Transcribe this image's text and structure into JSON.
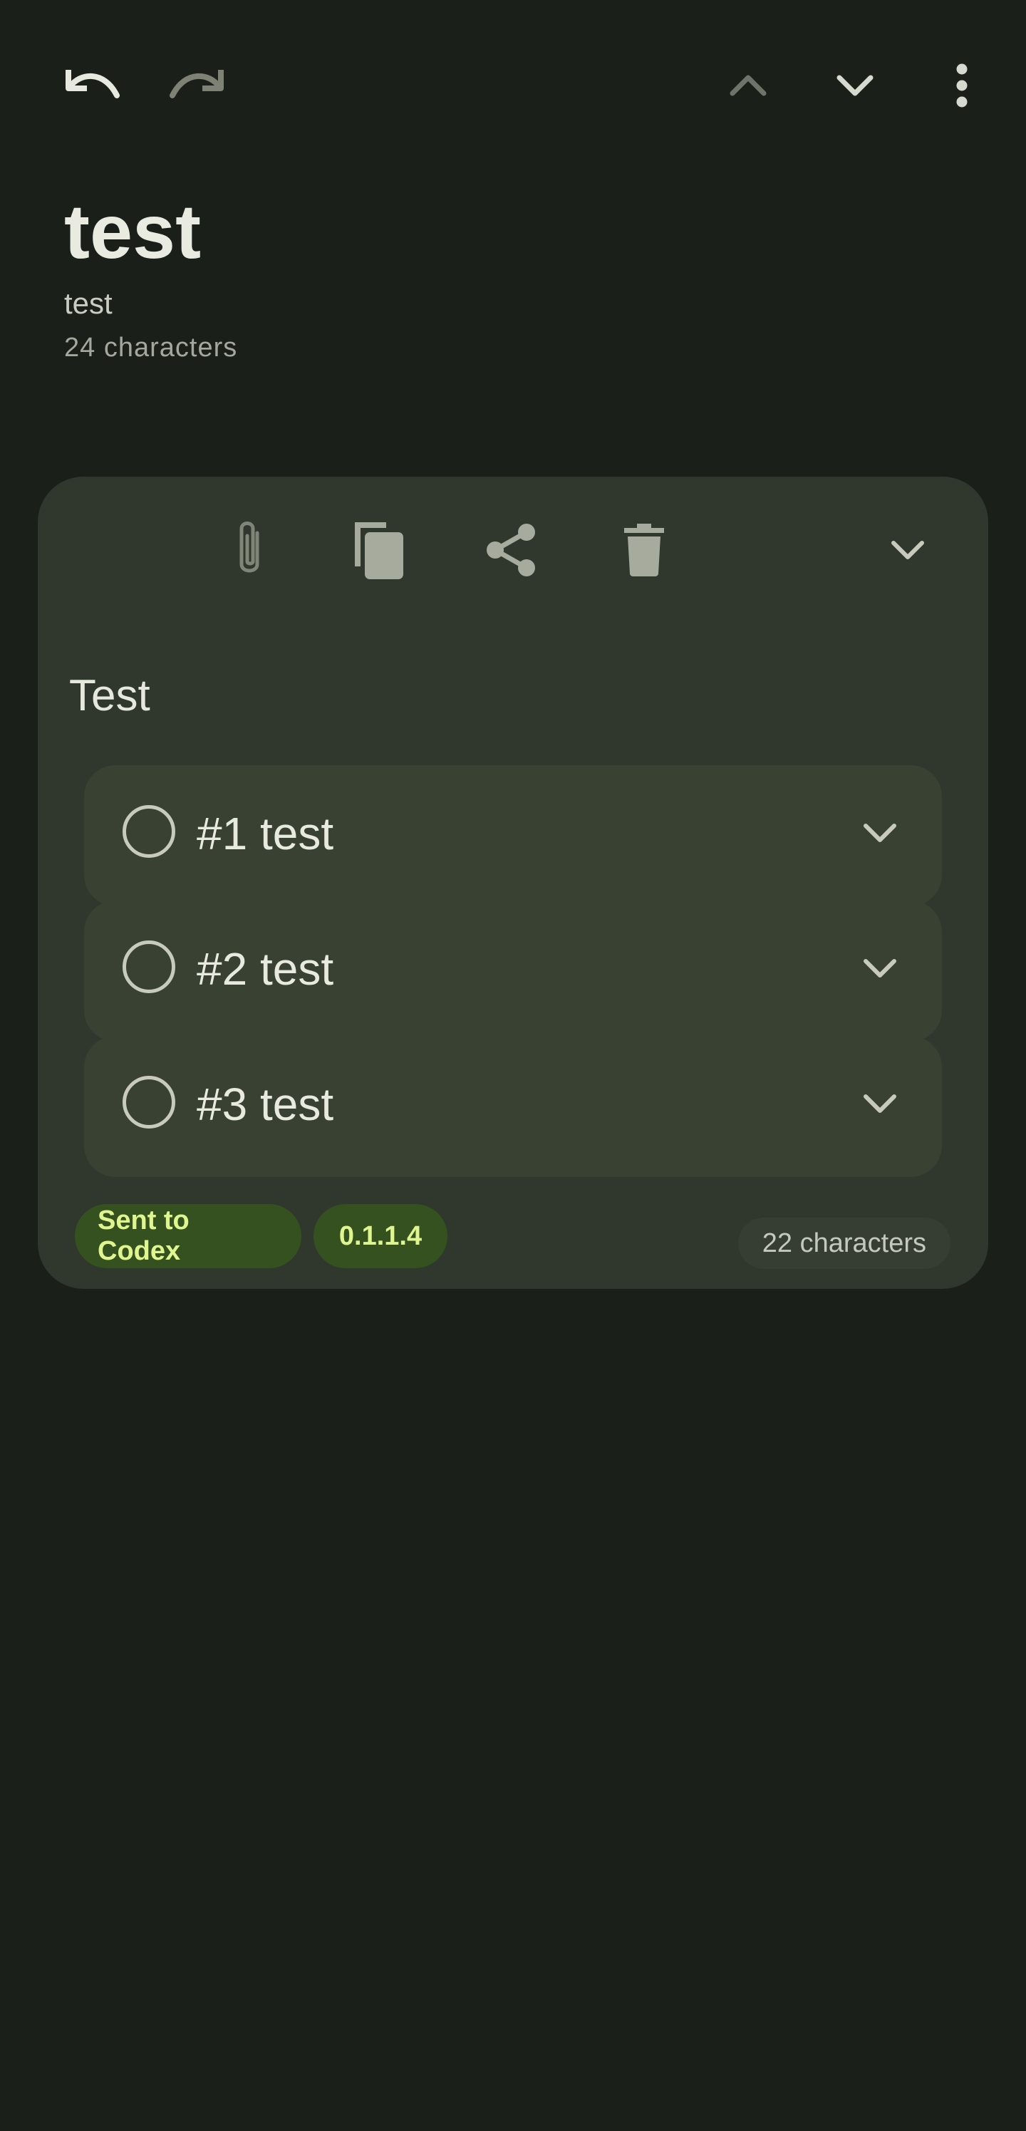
{
  "toolbar": {
    "undo_icon": "undo-icon",
    "redo_icon": "redo-icon",
    "prev_icon": "chevron-up-icon",
    "next_icon": "chevron-down-icon",
    "more_icon": "more-vert-icon"
  },
  "note": {
    "title": "test",
    "subtitle": "test",
    "char_count": "24 characters"
  },
  "card": {
    "tools": [
      "attach-icon",
      "copy-icon",
      "share-icon",
      "delete-icon",
      "chevron-down-icon"
    ],
    "heading": "Test",
    "items": [
      {
        "label": "#1 test",
        "checked": false
      },
      {
        "label": "#2 test",
        "checked": false
      },
      {
        "label": "#3 test",
        "checked": false
      }
    ],
    "chips": [
      "Sent to Codex",
      "0.1.1.4"
    ],
    "char_count": "22 characters"
  },
  "colors": {
    "background": "#1b1f1a",
    "card": "#30372d",
    "item": "#394133",
    "chip_bg": "#35511f",
    "chip_text": "#dff58f"
  }
}
